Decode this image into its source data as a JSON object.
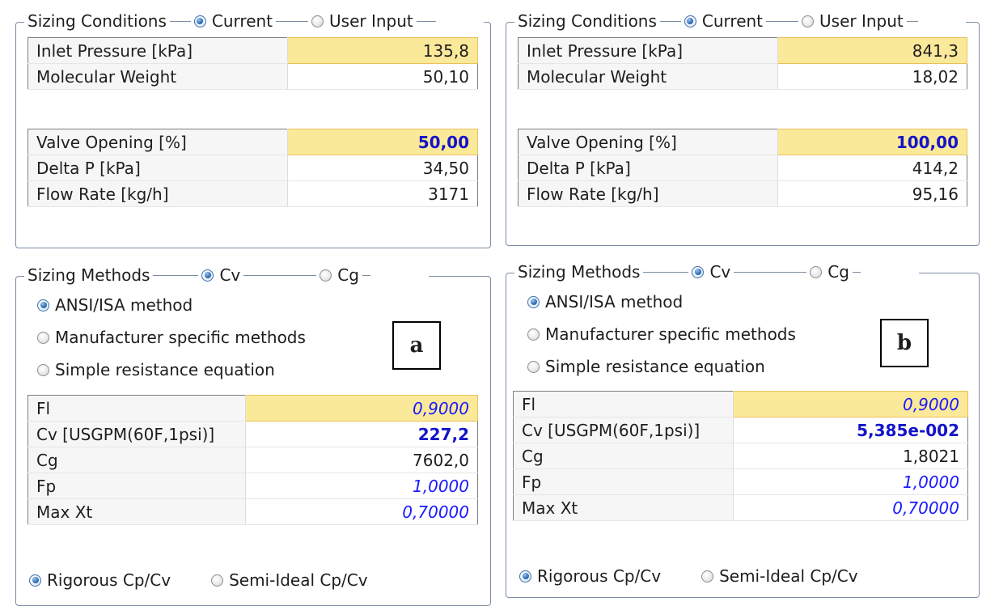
{
  "panels": [
    {
      "tag": "a",
      "conditions": {
        "title": "Sizing Conditions",
        "mode_current": "Current",
        "mode_user": "User Input",
        "rows1": [
          {
            "label": "Inlet Pressure [kPa]",
            "value": "135,8"
          },
          {
            "label": "Molecular Weight",
            "value": "50,10"
          }
        ],
        "rows2": [
          {
            "label": "Valve Opening [%]",
            "value": "50,00"
          },
          {
            "label": "Delta P [kPa]",
            "value": "34,50"
          },
          {
            "label": "Flow Rate [kg/h]",
            "value": "3171"
          }
        ]
      },
      "methods": {
        "title": "Sizing Methods",
        "opt_cv": "Cv",
        "opt_cg": "Cg",
        "list": [
          "ANSI/ISA method",
          "Manufacturer specific methods",
          "Simple resistance equation"
        ],
        "rows": [
          {
            "label": "Fl",
            "value": "0,9000"
          },
          {
            "label": "Cv [USGPM(60F,1psi)]",
            "value": "227,2"
          },
          {
            "label": "Cg",
            "value": "7602,0"
          },
          {
            "label": "Fp",
            "value": "1,0000"
          },
          {
            "label": "Max Xt",
            "value": "0,70000"
          }
        ],
        "rigorous": "Rigorous Cp/Cv",
        "semi_ideal": "Semi-Ideal Cp/Cv"
      }
    },
    {
      "tag": "b",
      "conditions": {
        "title": "Sizing Conditions",
        "mode_current": "Current",
        "mode_user": "User Input",
        "rows1": [
          {
            "label": "Inlet Pressure [kPa]",
            "value": "841,3"
          },
          {
            "label": "Molecular Weight",
            "value": "18,02"
          }
        ],
        "rows2": [
          {
            "label": "Valve Opening [%]",
            "value": "100,00"
          },
          {
            "label": "Delta P [kPa]",
            "value": "414,2"
          },
          {
            "label": "Flow Rate [kg/h]",
            "value": "95,16"
          }
        ]
      },
      "methods": {
        "title": "Sizing Methods",
        "opt_cv": "Cv",
        "opt_cg": "Cg",
        "list": [
          "ANSI/ISA method",
          "Manufacturer specific methods",
          "Simple resistance equation"
        ],
        "rows": [
          {
            "label": "Fl",
            "value": "0,9000"
          },
          {
            "label": "Cv [USGPM(60F,1psi)]",
            "value": "5,385e-002"
          },
          {
            "label": "Cg",
            "value": "1,8021"
          },
          {
            "label": "Fp",
            "value": "1,0000"
          },
          {
            "label": "Max Xt",
            "value": "0,70000"
          }
        ],
        "rigorous": "Rigorous Cp/Cv",
        "semi_ideal": "Semi-Ideal Cp/Cv"
      }
    }
  ]
}
